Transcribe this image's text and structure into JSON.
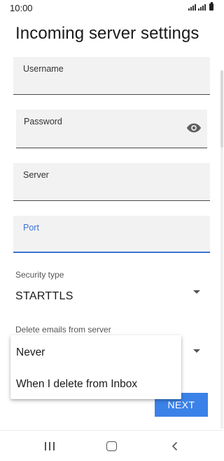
{
  "status_bar": {
    "time": "10:00"
  },
  "header": {
    "title": "Incoming server settings"
  },
  "form": {
    "username": {
      "label": "Username",
      "value": ""
    },
    "password": {
      "label": "Password",
      "value": ""
    },
    "server": {
      "label": "Server",
      "value": ""
    },
    "port": {
      "label": "Port",
      "value": "",
      "focused": true
    },
    "security_type": {
      "label": "Security type",
      "value": "STARTTLS"
    },
    "delete_emails": {
      "label": "Delete emails from server",
      "options": [
        "Never",
        "When I delete from Inbox"
      ]
    }
  },
  "actions": {
    "next_label": "NEXT"
  },
  "colors": {
    "accent": "#3a74d9",
    "button": "#3b82e8",
    "field_bg": "#f2f2f3"
  },
  "nav_bar": {
    "icons": [
      "recent-apps-icon",
      "home-icon",
      "back-icon"
    ]
  }
}
